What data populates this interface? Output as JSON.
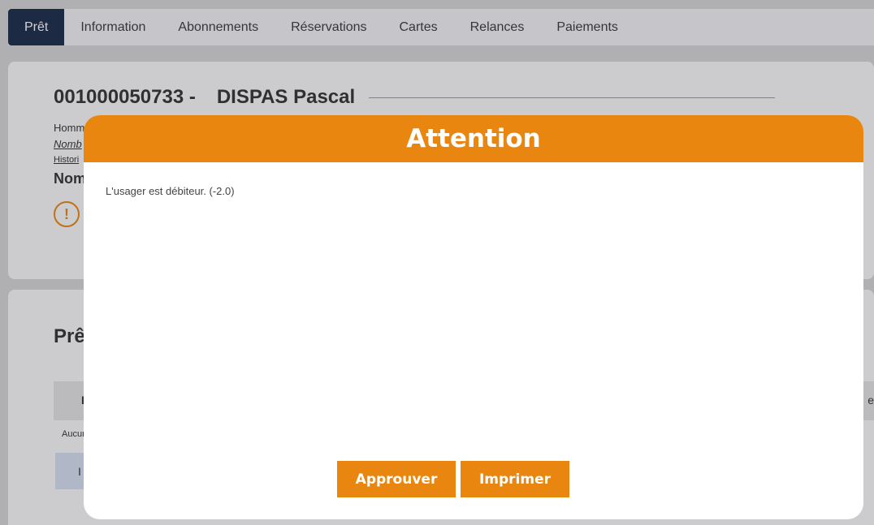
{
  "tabs": [
    {
      "label": "Prêt",
      "active": true
    },
    {
      "label": "Information"
    },
    {
      "label": "Abonnements"
    },
    {
      "label": "Réservations"
    },
    {
      "label": "Cartes"
    },
    {
      "label": "Relances"
    },
    {
      "label": "Paiements"
    }
  ],
  "user": {
    "id": "001000050733 -",
    "name": "DISPAS Pascal",
    "gender_partial": "Homm",
    "count_partial": "Nomb",
    "history_partial": "Histori",
    "nom_partial": "Nom",
    "warning_symbol": "!"
  },
  "loans": {
    "title_partial": "Prê",
    "col_first_partial": "I",
    "col_last_partial": "e",
    "empty_partial": "Aucun",
    "button_partial": "I"
  },
  "dialog": {
    "title": "Attention",
    "message": "L'usager est débiteur. (-2.0)",
    "approve_label": "Approuver",
    "print_label": "Imprimer"
  },
  "colors": {
    "accent": "#e8860f",
    "active_tab": "#1a2b4a"
  }
}
